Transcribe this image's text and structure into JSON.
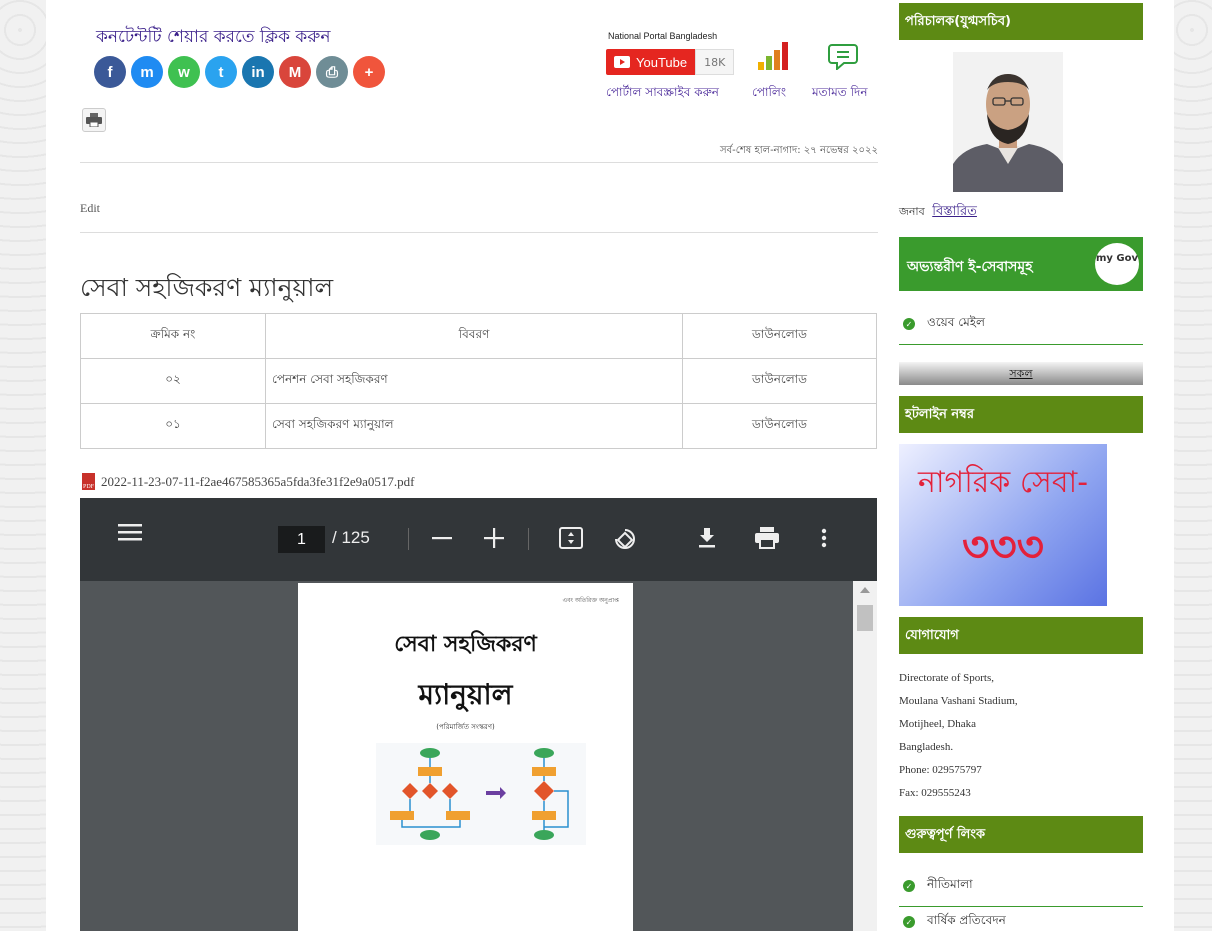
{
  "share": {
    "title": "কনটেন্টটি শেয়ার করতে ক্লিক করুন",
    "icons": [
      {
        "name": "facebook-icon",
        "glyph": "f",
        "color": "#3b5998"
      },
      {
        "name": "messenger-icon",
        "glyph": "m",
        "color": "#1f8bf2"
      },
      {
        "name": "whatsapp-icon",
        "glyph": "w",
        "color": "#3fc151"
      },
      {
        "name": "twitter-icon",
        "glyph": "t",
        "color": "#2aa3ef"
      },
      {
        "name": "linkedin-icon",
        "glyph": "in",
        "color": "#1a76b0"
      },
      {
        "name": "gmail-icon",
        "glyph": "M",
        "color": "#d9453b"
      },
      {
        "name": "print-icon",
        "glyph": "⎙",
        "color": "#6f8d96"
      },
      {
        "name": "more-share-icon",
        "glyph": "+",
        "color": "#f0553c"
      }
    ]
  },
  "header": {
    "national_portal": "National Portal Bangladesh",
    "youtube_label": "YouTube",
    "youtube_count": "18K",
    "subscribe": "পোর্টাল সাবস্ক্রাইব করুন",
    "poll": "পোলিং",
    "feedback": "মতামত দিন",
    "updated": "সর্ব-শেষ হাল-নাগাদ: ২৭ নভেম্বর ২০২২"
  },
  "edit_label": "Edit",
  "page_title": "সেবা সহজিকরণ ম্যানুয়াল",
  "table": {
    "headers": [
      "ক্রমিক নং",
      "বিবরণ",
      "ডাউনলোড"
    ],
    "rows": [
      [
        "০২",
        "পেনশন সেবা সহজিকরণ",
        "ডাউনলোড"
      ],
      [
        "০১",
        "সেবা সহজিকরণ ম্যানুয়াল",
        "ডাউনলোড"
      ]
    ]
  },
  "pdf": {
    "filename": "2022-11-23-07-11-f2ae467585365a5fda3fe31f2e9a0517.pdf",
    "current_page": "1",
    "total_pages": "/ 125",
    "doc_small": "এবং অতিরিক্ত অনুপ্রাপ্ত",
    "doc_title1": "সেবা সহজিকরণ",
    "doc_title2": "ম্যানুয়াল",
    "doc_subtitle": "(পরিমার্জিত সংস্করণ)"
  },
  "sidebar": {
    "director_heading": "পরিচালক(যুগ্মসচিব)",
    "name_prefix": "জনাব",
    "details": "বিস্তারিত",
    "eservice_heading": "অভ্যন্তরীণ ই-সেবাসমূহ",
    "mygov": "my Gov",
    "webmail": "ওয়েব মেইল",
    "all": "সকল",
    "hotline_heading": "হটলাইন নম্বর",
    "hotline_text": "নাগরিক সেবা-",
    "hotline_number": "৩৩৩",
    "contact_heading": "যোগাযোগ",
    "contact_lines": [
      "Directorate of Sports,",
      "Moulana Vashani Stadium,",
      "Motijheel, Dhaka",
      "Bangladesh.",
      "Phone: 029575797",
      "Fax: 029555243"
    ],
    "links_heading": "গুরুত্বপূর্ণ লিংক",
    "link1": "নীতিমালা",
    "link2": "বার্ষিক প্রতিবেদন"
  }
}
